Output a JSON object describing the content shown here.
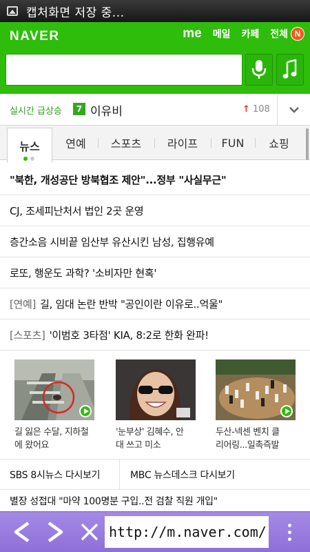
{
  "status_bar": {
    "notification_text": "캡처화면 저장 중..."
  },
  "header": {
    "logo": "NAVER",
    "links": {
      "me": "me",
      "mail": "메일",
      "cafe": "카페",
      "all": "전체",
      "badge": "N"
    }
  },
  "search": {
    "placeholder": ""
  },
  "realtime": {
    "label": "실시간 급상승",
    "rank": "7",
    "keyword": "이유비",
    "change_arrow": "↑",
    "change": "108"
  },
  "tabs": [
    "뉴스",
    "연예",
    "스포츠",
    "라이프",
    "FUN",
    "쇼핑"
  ],
  "news": [
    {
      "category": "",
      "title": "\"북한, 개성공단 방북협조 제안\"...정부 \"사실무근\"",
      "bold": true
    },
    {
      "category": "",
      "title": "CJ, 조세피난처서 법인 2곳 운영",
      "bold": false
    },
    {
      "category": "",
      "title": "층간소음 시비끝 임산부 유산시킨 남성, 집행유예",
      "bold": false
    },
    {
      "category": "",
      "title": "로또, 행운도 과학? '소비자만 현혹'",
      "bold": false
    },
    {
      "category": "[연예]",
      "title": "길, 임대 논란 반박 \"공인이란 이유로..억울\"",
      "bold": false
    },
    {
      "category": "[스포츠]",
      "title": "'이범호 3타점' KIA, 8:2로 한화 완파!",
      "bold": false
    }
  ],
  "photo_news": [
    {
      "line1": "길 잃은 수달, 지하철",
      "line2": "에 왔어요"
    },
    {
      "line1": "'눈부상' 김혜수, 안",
      "line2": "대 쓰고 미소"
    },
    {
      "line1": "두산-넥센 벤치 클",
      "line2": "리어링...일촉즉발"
    }
  ],
  "video_links": [
    "SBS 8시뉴스 다시보기",
    "MBC 뉴스데스크 다시보기"
  ],
  "partial_headline": "별장 성접대 \"마약 100명분 구입..전 검찰 직원 개입\"",
  "browser": {
    "url": "http://m.naver.com/"
  },
  "colors": {
    "naver_green": "#2ebd0a",
    "browser_bar": "#9b7fe0",
    "realtime_green": "#2a9c1a",
    "up_red": "#e53020"
  }
}
